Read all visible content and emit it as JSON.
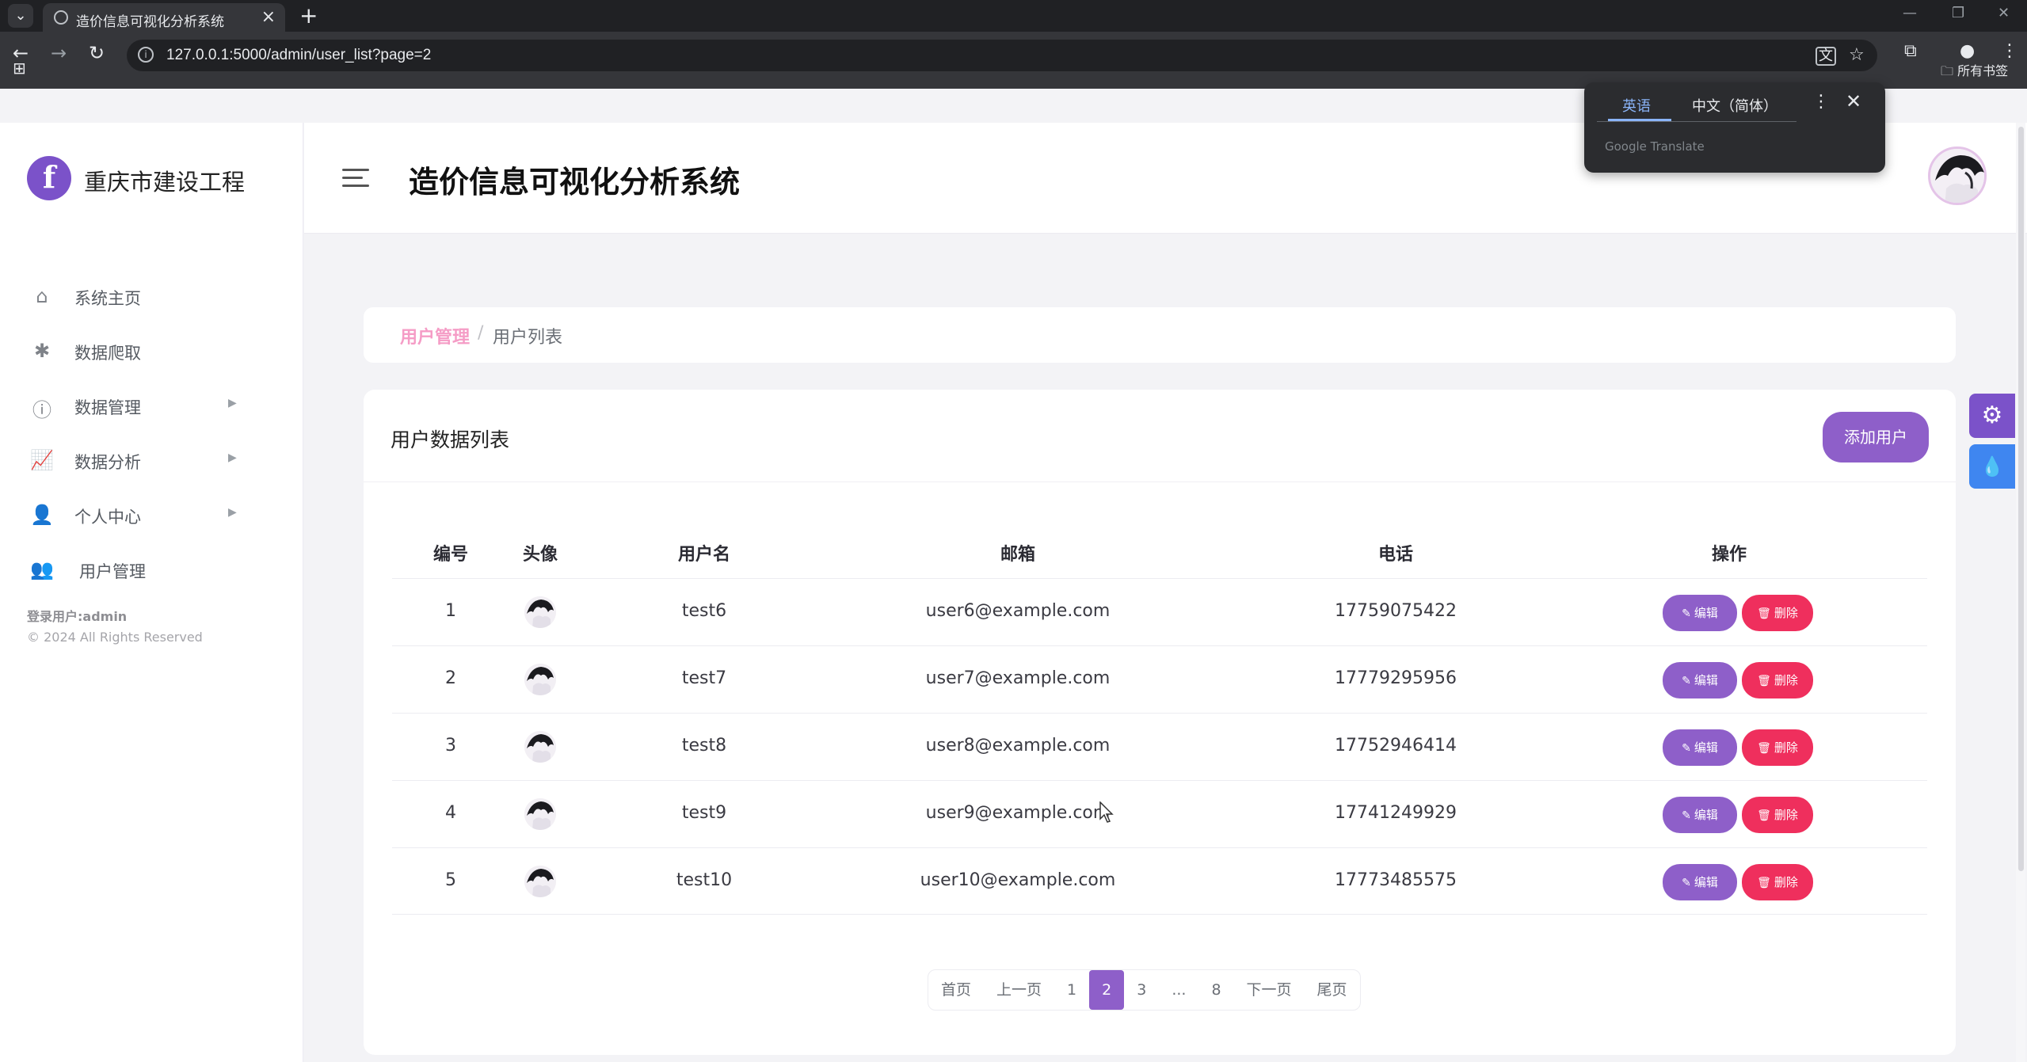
{
  "browser": {
    "tab_title": "造价信息可视化分析系统",
    "url": "127.0.0.1:5000/admin/user_list?page=2",
    "bookmark_folder": "所有书签",
    "icons": [
      "tab-list-icon",
      "favicon-icon",
      "close-icon",
      "new-tab-icon",
      "back-icon",
      "forward-icon",
      "reload-icon",
      "site-info-icon",
      "translate-icon",
      "star-icon",
      "extensions-icon",
      "profile-icon",
      "more-icon",
      "apps-icon",
      "folder-icon"
    ]
  },
  "translate_popup": {
    "tab_source": "英语",
    "tab_target": "中文（简体）",
    "brand": "Google Translate"
  },
  "sidebar": {
    "logo_letter": "f",
    "logo_text": "重庆市建设工程",
    "items": [
      {
        "label": "系统主页",
        "icon": "home-icon",
        "has_arrow": false
      },
      {
        "label": "数据爬取",
        "icon": "spider-icon",
        "has_arrow": false
      },
      {
        "label": "数据管理",
        "icon": "info-icon",
        "has_arrow": true
      },
      {
        "label": "数据分析",
        "icon": "chart-icon",
        "has_arrow": true
      },
      {
        "label": "个人中心",
        "icon": "user-icon",
        "has_arrow": true
      },
      {
        "label": "用户管理",
        "icon": "user-cog-icon",
        "has_arrow": false
      }
    ],
    "login_user": "登录用户:admin",
    "copyright": "© 2024 All Rights Reserved"
  },
  "header": {
    "title": "造价信息可视化分析系统"
  },
  "breadcrumb": {
    "parent": "用户管理",
    "separator": "/",
    "current": "用户列表"
  },
  "card": {
    "title": "用户数据列表",
    "add_button": "添加用户"
  },
  "table": {
    "columns": [
      "编号",
      "头像",
      "用户名",
      "邮箱",
      "电话",
      "操作"
    ],
    "edit_label": "编辑",
    "delete_label": "删除",
    "rows": [
      {
        "id": "1",
        "username": "test6",
        "email": "user6@example.com",
        "phone": "17759075422"
      },
      {
        "id": "2",
        "username": "test7",
        "email": "user7@example.com",
        "phone": "17779295956"
      },
      {
        "id": "3",
        "username": "test8",
        "email": "user8@example.com",
        "phone": "17752946414"
      },
      {
        "id": "4",
        "username": "test9",
        "email": "user9@example.com",
        "phone": "17741249929"
      },
      {
        "id": "5",
        "username": "test10",
        "email": "user10@example.com",
        "phone": "17773485575"
      }
    ]
  },
  "pagination": {
    "items": [
      "首页",
      "上一页",
      "1",
      "2",
      "3",
      "...",
      "8",
      "下一页",
      "尾页"
    ],
    "active": "2"
  },
  "colors": {
    "accent": "#8e5fc9",
    "danger": "#ef2f5d",
    "breadcrumb_link": "#f59cc6",
    "float_settings": "#7b52c9",
    "float_theme": "#3f86f0"
  }
}
